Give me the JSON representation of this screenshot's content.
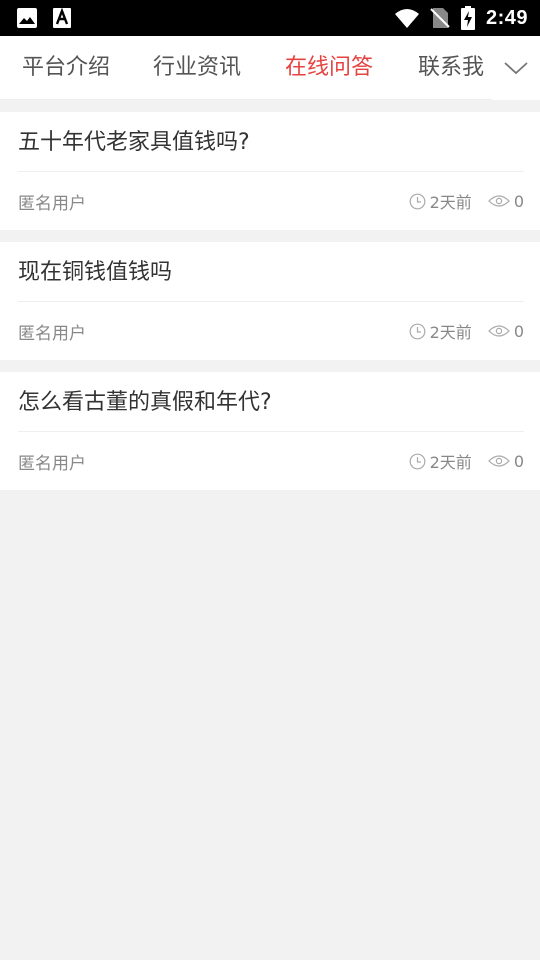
{
  "status": {
    "time": "2:49",
    "icons": [
      "image-icon",
      "font-a-icon",
      "wifi-icon",
      "no-sim-icon",
      "battery-charging-icon"
    ]
  },
  "tabs": [
    {
      "label": "平台介绍",
      "active": false
    },
    {
      "label": "行业资讯",
      "active": false
    },
    {
      "label": "在线问答",
      "active": true
    },
    {
      "label": "联系我",
      "active": false
    }
  ],
  "accent_color": "#e64340",
  "questions": [
    {
      "title": "五十年代老家具值钱吗?",
      "author": "匿名用户",
      "time": "2天前",
      "views": "0"
    },
    {
      "title": "现在铜钱值钱吗",
      "author": "匿名用户",
      "time": "2天前",
      "views": "0"
    },
    {
      "title": "怎么看古董的真假和年代?",
      "author": "匿名用户",
      "time": "2天前",
      "views": "0"
    }
  ]
}
